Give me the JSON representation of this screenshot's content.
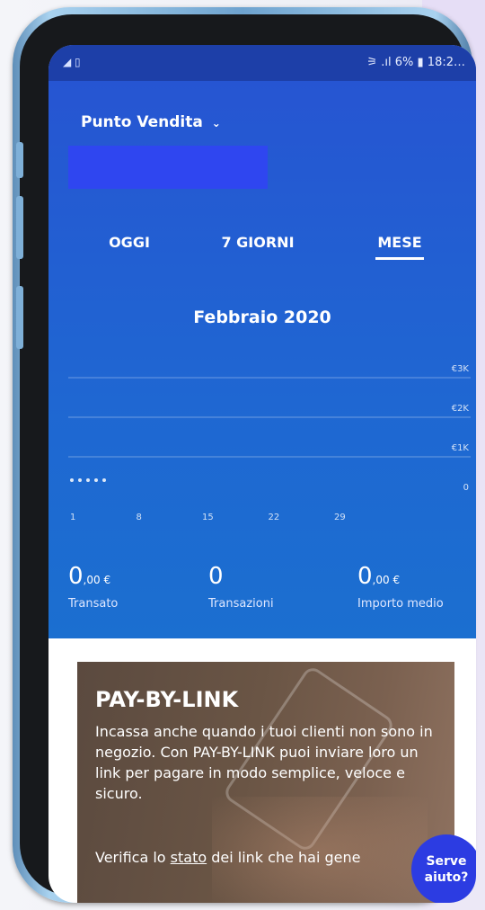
{
  "status_bar": {
    "left_icons": "◢ ▯",
    "right_text": "⚞ .ıl 6% ▮ 18:2…"
  },
  "header": {
    "store_label": "Punto Vendita",
    "store_chevron": "⌄"
  },
  "tabs": [
    {
      "label": "OGGI",
      "active": false
    },
    {
      "label": "7 GIORNI",
      "active": false
    },
    {
      "label": "MESE",
      "active": true
    }
  ],
  "period_title": "Febbraio 2020",
  "chart_data": {
    "type": "line",
    "x_ticks": [
      "1",
      "8",
      "15",
      "22",
      "29"
    ],
    "y_ticks": [
      "€3K",
      "€2K",
      "€1K",
      "0"
    ],
    "ylim": [
      0,
      3000
    ],
    "series": [
      {
        "x": [
          1,
          2,
          3,
          4,
          5
        ],
        "y": [
          0,
          0,
          0,
          0,
          0
        ]
      }
    ],
    "grid": true
  },
  "metrics": [
    {
      "value_main": "0",
      "value_cents": ",00 €",
      "label": "Transato"
    },
    {
      "value_main": "0",
      "value_cents": "",
      "label": "Transazioni"
    },
    {
      "value_main": "0",
      "value_cents": ",00 €",
      "label": "Importo medio"
    }
  ],
  "promo": {
    "title": "PAY-BY-LINK",
    "body": "Incassa anche quando i tuoi clienti non sono in negozio. Con PAY-BY-LINK puoi inviare loro un link per pagare in modo semplice, veloce e sicuro.",
    "link_prefix": "Verifica lo ",
    "link_word": "stato",
    "link_suffix": " dei link che hai gene"
  },
  "help_button": {
    "line1": "Serve",
    "line2": "aiuto?"
  },
  "colors": {
    "hero_blue": "#2355d0",
    "help_blue": "#2c3ce2",
    "phone_frame": "#7fb0d8"
  }
}
